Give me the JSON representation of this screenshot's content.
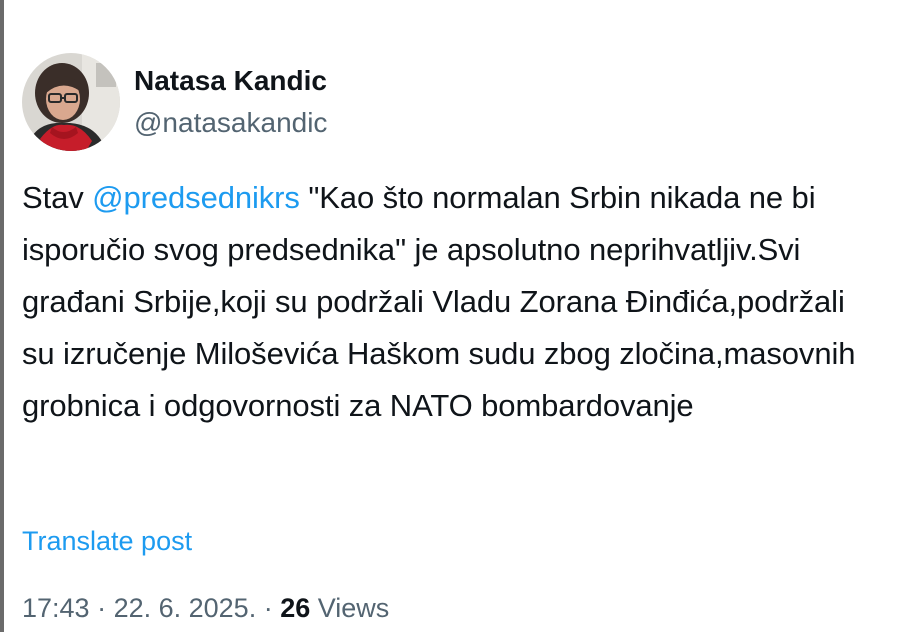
{
  "author": {
    "display_name": "Natasa Kandic",
    "handle": "@natasakandic",
    "avatar_icon": "profile-photo"
  },
  "post": {
    "text_before_mention": "Stav ",
    "mention": "@predsednikrs",
    "text_after_mention": " \"Kao što normalan Srbin nikada ne bi isporučio svog predsednika\" je apsolutno neprihvatljiv.Svi građani Srbije,koji su podržali Vladu Zorana Đinđića,podržali su izručenje Miloševića Haškom sudu zbog zločina,masovnih grobnica i odgovornosti za NATO bombardovanje"
  },
  "translate_label": "Translate post",
  "meta": {
    "time": "17:43",
    "separator1": " · ",
    "date": "22. 6. 2025.",
    "separator2": " · ",
    "views_count": "26",
    "views_label": " Views"
  },
  "colors": {
    "link": "#1d9bf0",
    "secondary_text": "#536471",
    "primary_text": "#0f1419"
  }
}
